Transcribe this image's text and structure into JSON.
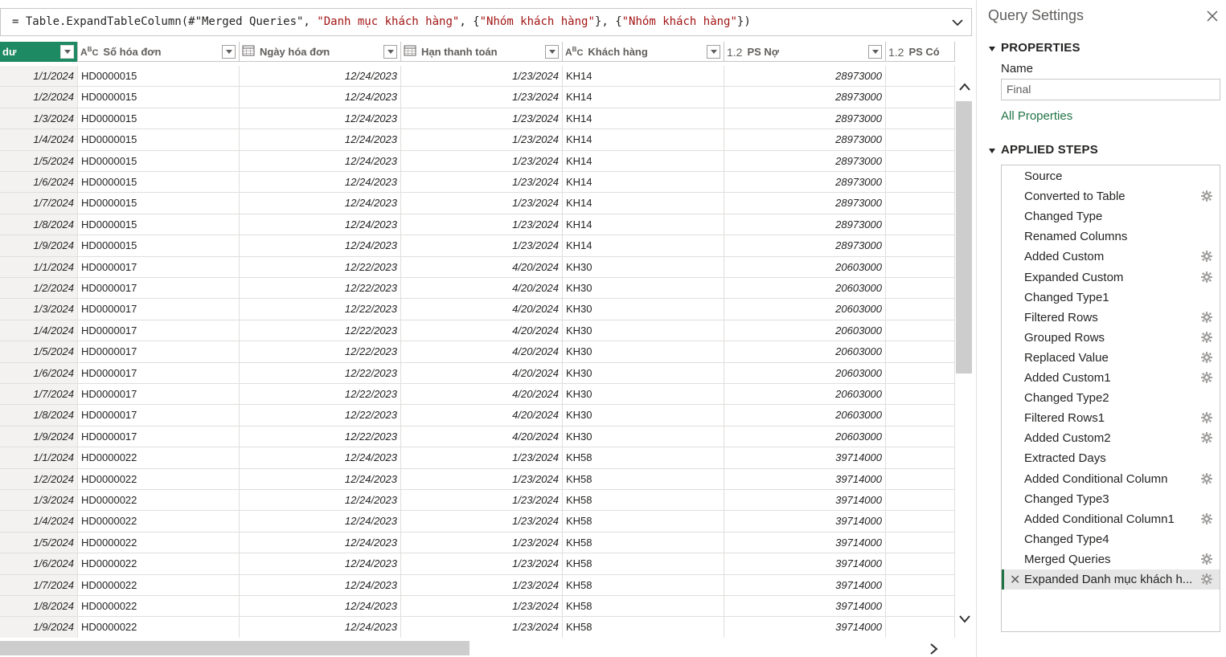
{
  "formula": {
    "prefix": "= Table.ExpandTableColumn(#\"Merged Queries\", ",
    "str1": "\"Danh mục khách hàng\"",
    "mid1": ", {",
    "str2": "\"Nhóm khách hàng\"",
    "mid2": "}, {",
    "str3": "\"Nhóm khách hàng\"",
    "suffix": "})"
  },
  "columns": [
    {
      "label": "dư",
      "type": "",
      "selected": true
    },
    {
      "label": "Số hóa đơn",
      "type": "ABC"
    },
    {
      "label": "Ngày hóa đơn",
      "type": "calendar"
    },
    {
      "label": "Hạn thanh toán",
      "type": "calendar"
    },
    {
      "label": "Khách hàng",
      "type": "ABC"
    },
    {
      "label": "PS Nợ",
      "type": "1.2"
    },
    {
      "label": "PS Có",
      "type": "1.2"
    }
  ],
  "rows": [
    [
      "1/1/2024",
      "HD0000015",
      "12/24/2023",
      "1/23/2024",
      "KH14",
      "28973000"
    ],
    [
      "1/2/2024",
      "HD0000015",
      "12/24/2023",
      "1/23/2024",
      "KH14",
      "28973000"
    ],
    [
      "1/3/2024",
      "HD0000015",
      "12/24/2023",
      "1/23/2024",
      "KH14",
      "28973000"
    ],
    [
      "1/4/2024",
      "HD0000015",
      "12/24/2023",
      "1/23/2024",
      "KH14",
      "28973000"
    ],
    [
      "1/5/2024",
      "HD0000015",
      "12/24/2023",
      "1/23/2024",
      "KH14",
      "28973000"
    ],
    [
      "1/6/2024",
      "HD0000015",
      "12/24/2023",
      "1/23/2024",
      "KH14",
      "28973000"
    ],
    [
      "1/7/2024",
      "HD0000015",
      "12/24/2023",
      "1/23/2024",
      "KH14",
      "28973000"
    ],
    [
      "1/8/2024",
      "HD0000015",
      "12/24/2023",
      "1/23/2024",
      "KH14",
      "28973000"
    ],
    [
      "1/9/2024",
      "HD0000015",
      "12/24/2023",
      "1/23/2024",
      "KH14",
      "28973000"
    ],
    [
      "1/1/2024",
      "HD0000017",
      "12/22/2023",
      "4/20/2024",
      "KH30",
      "20603000"
    ],
    [
      "1/2/2024",
      "HD0000017",
      "12/22/2023",
      "4/20/2024",
      "KH30",
      "20603000"
    ],
    [
      "1/3/2024",
      "HD0000017",
      "12/22/2023",
      "4/20/2024",
      "KH30",
      "20603000"
    ],
    [
      "1/4/2024",
      "HD0000017",
      "12/22/2023",
      "4/20/2024",
      "KH30",
      "20603000"
    ],
    [
      "1/5/2024",
      "HD0000017",
      "12/22/2023",
      "4/20/2024",
      "KH30",
      "20603000"
    ],
    [
      "1/6/2024",
      "HD0000017",
      "12/22/2023",
      "4/20/2024",
      "KH30",
      "20603000"
    ],
    [
      "1/7/2024",
      "HD0000017",
      "12/22/2023",
      "4/20/2024",
      "KH30",
      "20603000"
    ],
    [
      "1/8/2024",
      "HD0000017",
      "12/22/2023",
      "4/20/2024",
      "KH30",
      "20603000"
    ],
    [
      "1/9/2024",
      "HD0000017",
      "12/22/2023",
      "4/20/2024",
      "KH30",
      "20603000"
    ],
    [
      "1/1/2024",
      "HD0000022",
      "12/24/2023",
      "1/23/2024",
      "KH58",
      "39714000"
    ],
    [
      "1/2/2024",
      "HD0000022",
      "12/24/2023",
      "1/23/2024",
      "KH58",
      "39714000"
    ],
    [
      "1/3/2024",
      "HD0000022",
      "12/24/2023",
      "1/23/2024",
      "KH58",
      "39714000"
    ],
    [
      "1/4/2024",
      "HD0000022",
      "12/24/2023",
      "1/23/2024",
      "KH58",
      "39714000"
    ],
    [
      "1/5/2024",
      "HD0000022",
      "12/24/2023",
      "1/23/2024",
      "KH58",
      "39714000"
    ],
    [
      "1/6/2024",
      "HD0000022",
      "12/24/2023",
      "1/23/2024",
      "KH58",
      "39714000"
    ],
    [
      "1/7/2024",
      "HD0000022",
      "12/24/2023",
      "1/23/2024",
      "KH58",
      "39714000"
    ],
    [
      "1/8/2024",
      "HD0000022",
      "12/24/2023",
      "1/23/2024",
      "KH58",
      "39714000"
    ],
    [
      "1/9/2024",
      "HD0000022",
      "12/24/2023",
      "1/23/2024",
      "KH58",
      "39714000"
    ]
  ],
  "query_settings": {
    "title": "Query Settings",
    "properties_title": "PROPERTIES",
    "name_label": "Name",
    "name_value": "Final",
    "all_properties": "All Properties",
    "applied_steps_title": "APPLIED STEPS",
    "steps": [
      {
        "label": "Source",
        "gear": false
      },
      {
        "label": "Converted to Table",
        "gear": true
      },
      {
        "label": "Changed Type",
        "gear": false
      },
      {
        "label": "Renamed Columns",
        "gear": false
      },
      {
        "label": "Added Custom",
        "gear": true
      },
      {
        "label": "Expanded Custom",
        "gear": true
      },
      {
        "label": "Changed Type1",
        "gear": false
      },
      {
        "label": "Filtered Rows",
        "gear": true
      },
      {
        "label": "Grouped Rows",
        "gear": true
      },
      {
        "label": "Replaced Value",
        "gear": true
      },
      {
        "label": "Added Custom1",
        "gear": true
      },
      {
        "label": "Changed Type2",
        "gear": false
      },
      {
        "label": "Filtered Rows1",
        "gear": true
      },
      {
        "label": "Added Custom2",
        "gear": true
      },
      {
        "label": "Extracted Days",
        "gear": false
      },
      {
        "label": "Added Conditional Column",
        "gear": true
      },
      {
        "label": "Changed Type3",
        "gear": false
      },
      {
        "label": "Added Conditional Column1",
        "gear": true
      },
      {
        "label": "Changed Type4",
        "gear": false
      },
      {
        "label": "Merged Queries",
        "gear": true
      },
      {
        "label": "Expanded Danh mục khách h...",
        "gear": true,
        "active": true
      }
    ]
  },
  "colors": {
    "selected_header": "#1e8a63",
    "accent_link": "#217346"
  }
}
